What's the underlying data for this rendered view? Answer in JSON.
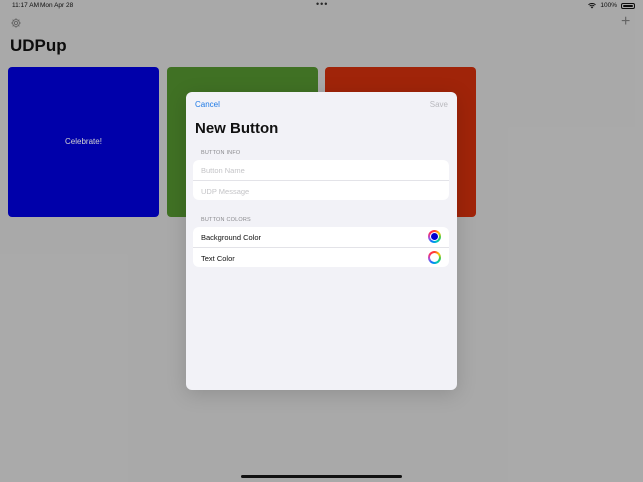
{
  "status_bar": {
    "time": "11:17 AM",
    "date": "Mon Apr 28",
    "battery": "100%"
  },
  "header": {
    "settings_icon": "gear-icon",
    "add_icon": "plus-icon",
    "add_glyph": "+"
  },
  "app": {
    "title": "UDPup"
  },
  "tiles": [
    {
      "label": "Celebrate!",
      "color": "#0000d0",
      "text_color": "#ffffff"
    },
    {
      "label": "",
      "color": "#4f8a2c",
      "text_color": "#ffffff"
    },
    {
      "label": "",
      "color": "#c42d0b",
      "text_color": "#ffffff"
    }
  ],
  "sheet": {
    "cancel_label": "Cancel",
    "save_label": "Save",
    "title": "New Button",
    "button_info": {
      "header": "BUTTON INFO",
      "name_placeholder": "Button Name",
      "name_value": "",
      "message_placeholder": "UDP Message",
      "message_value": ""
    },
    "button_colors": {
      "header": "BUTTON COLORS",
      "background_label": "Background Color",
      "background_value": "#0000d0",
      "text_label": "Text Color",
      "text_value": "#ffffff"
    }
  },
  "colors": {
    "accent": "#1f7ae6",
    "disabled": "#b9b9be"
  }
}
